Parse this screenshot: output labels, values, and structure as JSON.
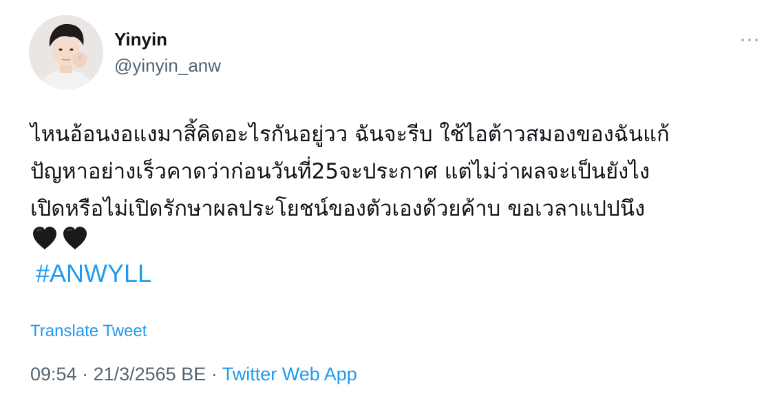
{
  "author": {
    "name": "Yinyin",
    "handle": "@yinyin_anw",
    "avatar_icon": "profile-photo"
  },
  "more_icon": "more-horizontal-icon",
  "tweet": {
    "lines": [
      "ไหนอ้อนงอแงมาสิ้คิดอะไรกันอยู่วว ฉันจะรีบ ใช้ไอต้าวสมองของฉันแก้",
      "ปัญหาอย่างเร็วคาดว่าก่อนวันที่25จะประกาศ แต่ไม่ว่าผลจะเป็นยังไง",
      "เปิดหรือไม่เปิดรักษาผลประโยชน์ของตัวเองด้วยค้าบ ขอเวลาแปปนึง"
    ],
    "emoji": [
      "black-heart",
      "black-heart"
    ],
    "hashtag": "#ANWYLL"
  },
  "translate_label": "Translate Tweet",
  "meta": {
    "time": "09:54",
    "separator": " · ",
    "date": "21/3/2565 BE",
    "source": "Twitter Web App"
  },
  "colors": {
    "link": "#1d9bf0",
    "secondary": "#536471",
    "text": "#0f1419"
  }
}
